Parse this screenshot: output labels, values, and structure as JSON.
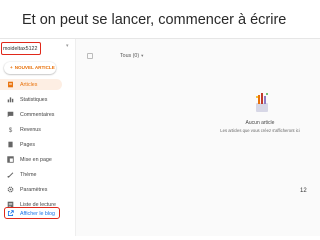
{
  "slide": {
    "title": "Et on peut se lancer, commencer à écrire",
    "number": "12"
  },
  "sidebar": {
    "blog_name": "moideltax5122",
    "new_post_label": "NOUVEL ARTICLE",
    "items": [
      {
        "label": "Articles",
        "icon": "document-icon",
        "active": true
      },
      {
        "label": "Statistiques",
        "icon": "chart-icon",
        "active": false
      },
      {
        "label": "Commentaires",
        "icon": "comment-icon",
        "active": false
      },
      {
        "label": "Revenus",
        "icon": "dollar-icon",
        "active": false
      },
      {
        "label": "Pages",
        "icon": "page-icon",
        "active": false
      },
      {
        "label": "Mise en page",
        "icon": "layout-icon",
        "active": false
      },
      {
        "label": "Thème",
        "icon": "palette-icon",
        "active": false
      },
      {
        "label": "Paramètres",
        "icon": "gear-icon",
        "active": false
      },
      {
        "label": "Liste de lecture",
        "icon": "list-icon",
        "active": false
      },
      {
        "label": "Afficher le blog",
        "icon": "external-link-icon",
        "active": false
      }
    ]
  },
  "main": {
    "filter_label": "Tous (0)",
    "empty_title": "Aucun article",
    "empty_subtitle": "Les articles que vous créez s'afficheront ici"
  },
  "colors": {
    "accent": "#e8710a",
    "highlight_box": "#e0281a",
    "active_bg": "#fdeee3"
  }
}
